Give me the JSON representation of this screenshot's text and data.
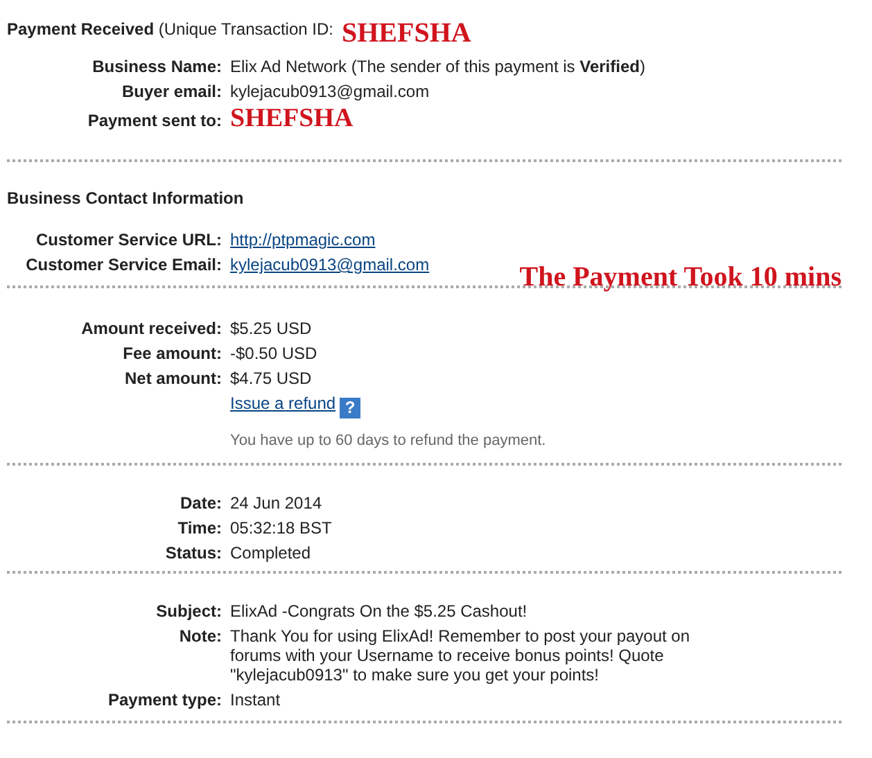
{
  "header": {
    "title": "**Payment Received** (Unique Transaction ID:",
    "annotation": "SHEFSHA"
  },
  "sections": [
    {
      "rows": [
        {
          "kind": "text",
          "label": "Business Name:",
          "value": "Elix Ad Network (The sender of this payment is **Verified**)"
        },
        {
          "kind": "text",
          "label": "Buyer email:",
          "value": "kylejacub0913@gmail.com"
        },
        {
          "kind": "annotation",
          "label": "Payment sent to:",
          "value": "SHEFSHA"
        }
      ]
    },
    {
      "heading": "Business Contact Information",
      "annotation": "The Payment Took 10 mins",
      "rows": [
        {
          "kind": "link",
          "label": "Customer Service URL:",
          "value": "http://ptpmagic.com"
        },
        {
          "kind": "link",
          "label": "Customer Service Email:",
          "value": "kylejacub0913@gmail.com"
        }
      ]
    },
    {
      "rows": [
        {
          "kind": "text",
          "label": "Amount received:",
          "value": "$5.25 USD"
        },
        {
          "kind": "text",
          "label": "Fee amount:",
          "value": "-$0.50 USD"
        },
        {
          "kind": "text",
          "label": "Net amount:",
          "value": "$4.75 USD"
        },
        {
          "kind": "refund",
          "value": "Issue a refund",
          "help": "?"
        },
        {
          "kind": "hint",
          "value": "You have up to 60 days to refund the payment."
        }
      ]
    },
    {
      "rows": [
        {
          "kind": "text",
          "label": "Date:",
          "value": "24 Jun 2014"
        },
        {
          "kind": "text",
          "label": "Time:",
          "value": "05:32:18 BST"
        },
        {
          "kind": "text",
          "label": "Status:",
          "value": "Completed"
        }
      ]
    },
    {
      "rows": [
        {
          "kind": "text",
          "label": "Subject:",
          "value": "ElixAd -Congrats On the $5.25 Cashout!"
        },
        {
          "kind": "text",
          "label": "Note:",
          "value": "Thank You for using ElixAd! Remember to post your payout on forums with your Username to receive bonus points! Quote \"kylejacub0913\" to make sure you get your points!"
        },
        {
          "kind": "text",
          "label": "Payment type:",
          "value": "Instant"
        }
      ]
    }
  ]
}
